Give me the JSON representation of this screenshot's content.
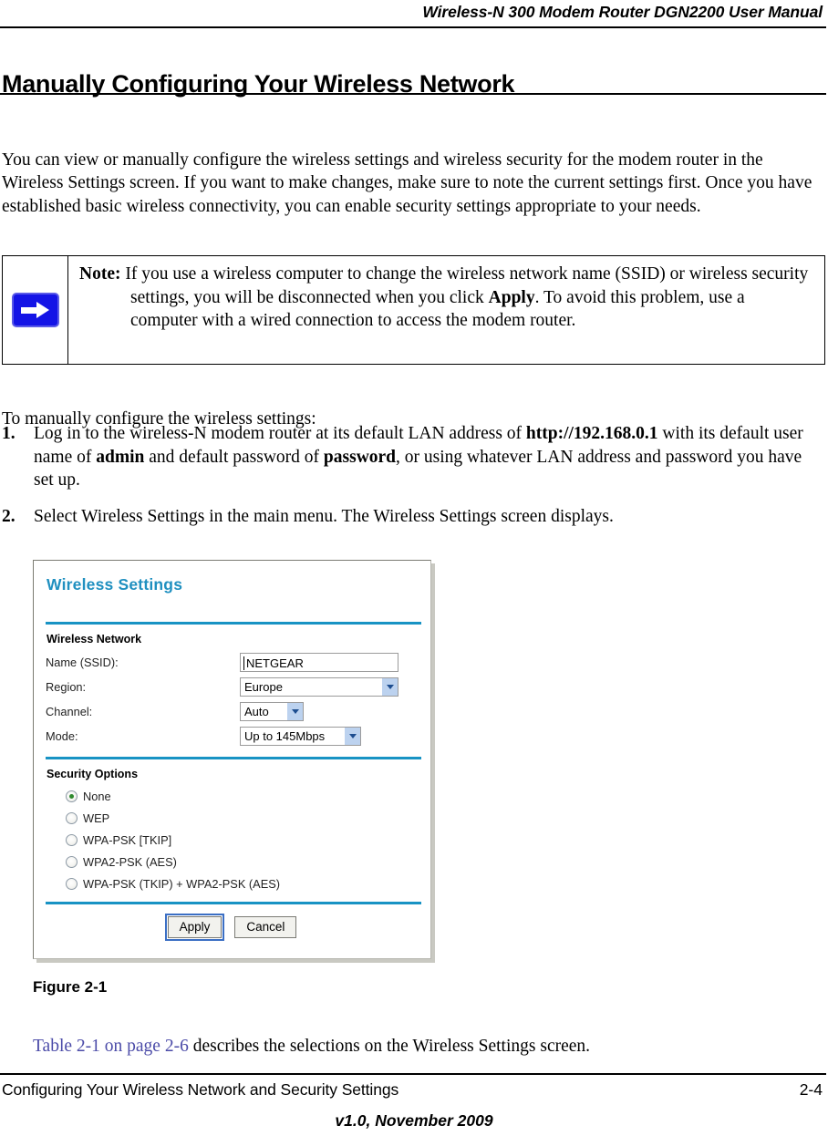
{
  "header": {
    "running_title": "Wireless-N 300 Modem Router DGN2200 User Manual"
  },
  "section": {
    "title": "Manually Configuring Your Wireless Network"
  },
  "intro": {
    "paragraph": "You can view or manually configure the wireless settings and wireless security for the modem router in the Wireless Settings screen. If you want to make changes, make sure to note the current settings first. Once you have established basic wireless connectivity, you can enable security settings appropriate to your needs."
  },
  "note": {
    "icon": "blue-right-arrow-icon",
    "label": "Note:",
    "text_before_bold": " If you use a wireless computer to change the wireless network name (SSID) or wireless security settings, you will be disconnected when you click ",
    "bold_word": "Apply",
    "text_after_bold": ". To avoid this problem, use a computer with a wired connection to access the modem router."
  },
  "leadin": "To manually configure the wireless settings:",
  "steps": [
    {
      "number": "1.",
      "part1": "Log in to the wireless-N modem router at its default LAN address of ",
      "bold1": "http://192.168.0.1",
      "part2": " with its default user name of ",
      "bold2": "admin",
      "part3": " and default password of ",
      "bold3": "password",
      "part4": ", or using whatever LAN address and password you have set up."
    },
    {
      "number": "2.",
      "part1": "Select Wireless Settings in the main menu. The Wireless Settings screen displays.",
      "bold1": "",
      "part2": "",
      "bold2": "",
      "part3": "",
      "bold3": "",
      "part4": ""
    }
  ],
  "figure": {
    "ui": {
      "title": "Wireless Settings",
      "network_group_label": "Wireless Network",
      "fields": [
        {
          "label": "Name (SSID):",
          "value": "NETGEAR",
          "control": "text-input"
        },
        {
          "label": "Region:",
          "value": "Europe",
          "control": "dropdown"
        },
        {
          "label": "Channel:",
          "value": "Auto",
          "control": "dropdown"
        },
        {
          "label": "Mode:",
          "value": "Up to 145Mbps",
          "control": "dropdown"
        }
      ],
      "security_group_label": "Security Options",
      "security_options": [
        {
          "label": "None",
          "selected": true
        },
        {
          "label": "WEP",
          "selected": false
        },
        {
          "label": "WPA-PSK [TKIP]",
          "selected": false
        },
        {
          "label": "WPA2-PSK (AES)",
          "selected": false
        },
        {
          "label": "WPA-PSK (TKIP) + WPA2-PSK (AES)",
          "selected": false
        }
      ],
      "buttons": {
        "apply": "Apply",
        "cancel": "Cancel"
      },
      "colors": {
        "title_blue": "#2090c0",
        "divider_blue": "#1893c4",
        "dropdown_arrow_bg": "#bcd2ef",
        "radio_dot_green": "#2f8a2f"
      }
    },
    "caption": "Figure 2-1"
  },
  "after_figure": {
    "link_text": "Table 2-1 on page 2-6",
    "rest": " describes the selections on the Wireless Settings screen."
  },
  "footer": {
    "left": "Configuring Your Wireless Network and Security Settings",
    "page_number": "2-4",
    "version": "v1.0, November 2009"
  }
}
